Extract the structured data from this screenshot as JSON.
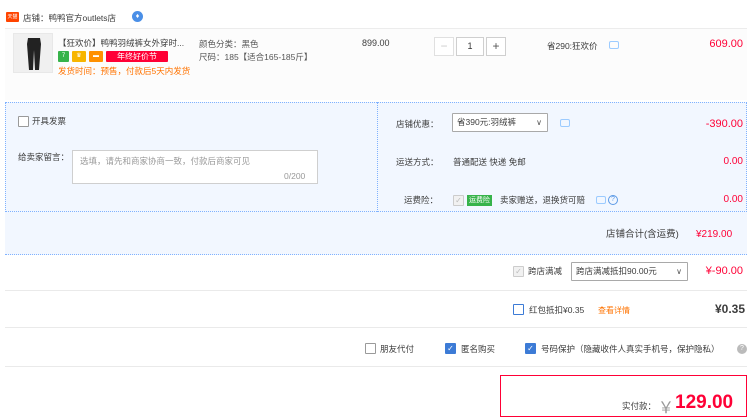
{
  "store": {
    "tag": "天猫",
    "name": "店铺：鸭鸭官方outlets店",
    "badge": "♦"
  },
  "item": {
    "title": "【狂欢价】鸭鸭羽绒裤女外穿时...",
    "icons": [
      "7",
      "♛",
      "▬"
    ],
    "promo_badge": "年终好价节",
    "shipping_note": "发货时间：预售，付款后5天内发货",
    "sku_color": "颜色分类：黑色",
    "sku_size": "尺码：185【适合165-185斤】",
    "unit_price": "899.00",
    "qty_minus": "−",
    "quantity": "1",
    "qty_plus": "+",
    "savings": "省290:狂欢价",
    "row_total": "609.00"
  },
  "invoice": {
    "label": "开具发票"
  },
  "message": {
    "label": "给卖家留言：",
    "placeholder": "选填，请先和商家协商一致，付款后商家可见",
    "counter": "0/200"
  },
  "discount": {
    "label": "店铺优惠：",
    "selected": "省390元:羽绒裤",
    "amount": "-390.00"
  },
  "delivery": {
    "label": "运送方式：",
    "value": "普通配送 快递 免邮",
    "amount": "0.00"
  },
  "insurance": {
    "label": "运费险：",
    "tag": "运费险",
    "value": "卖家赠送，退换货可赔",
    "amount": "0.00"
  },
  "store_total": {
    "label": "店铺合计(含运费)",
    "amount": "¥219.00"
  },
  "cross_store": {
    "label": "跨店满减",
    "selected": "跨店满减抵扣90.00元",
    "amount": "¥-90.00"
  },
  "red_packet": {
    "label": "红包抵扣¥0.35",
    "link": "查看详情",
    "amount": "¥0.35"
  },
  "options": {
    "friend_pay": "朋友代付",
    "anonymous": "匿名购买",
    "number_protect": "号码保护（隐藏收件人真实手机号，保护隐私）"
  },
  "payment": {
    "label": "实付款：",
    "currency": "￥",
    "amount": "129.00"
  },
  "colors": {
    "accent_red": "#ff0036",
    "blue_bg": "#f2f7ff",
    "check_blue": "#3c7bd6",
    "orange": "#ff7300"
  }
}
